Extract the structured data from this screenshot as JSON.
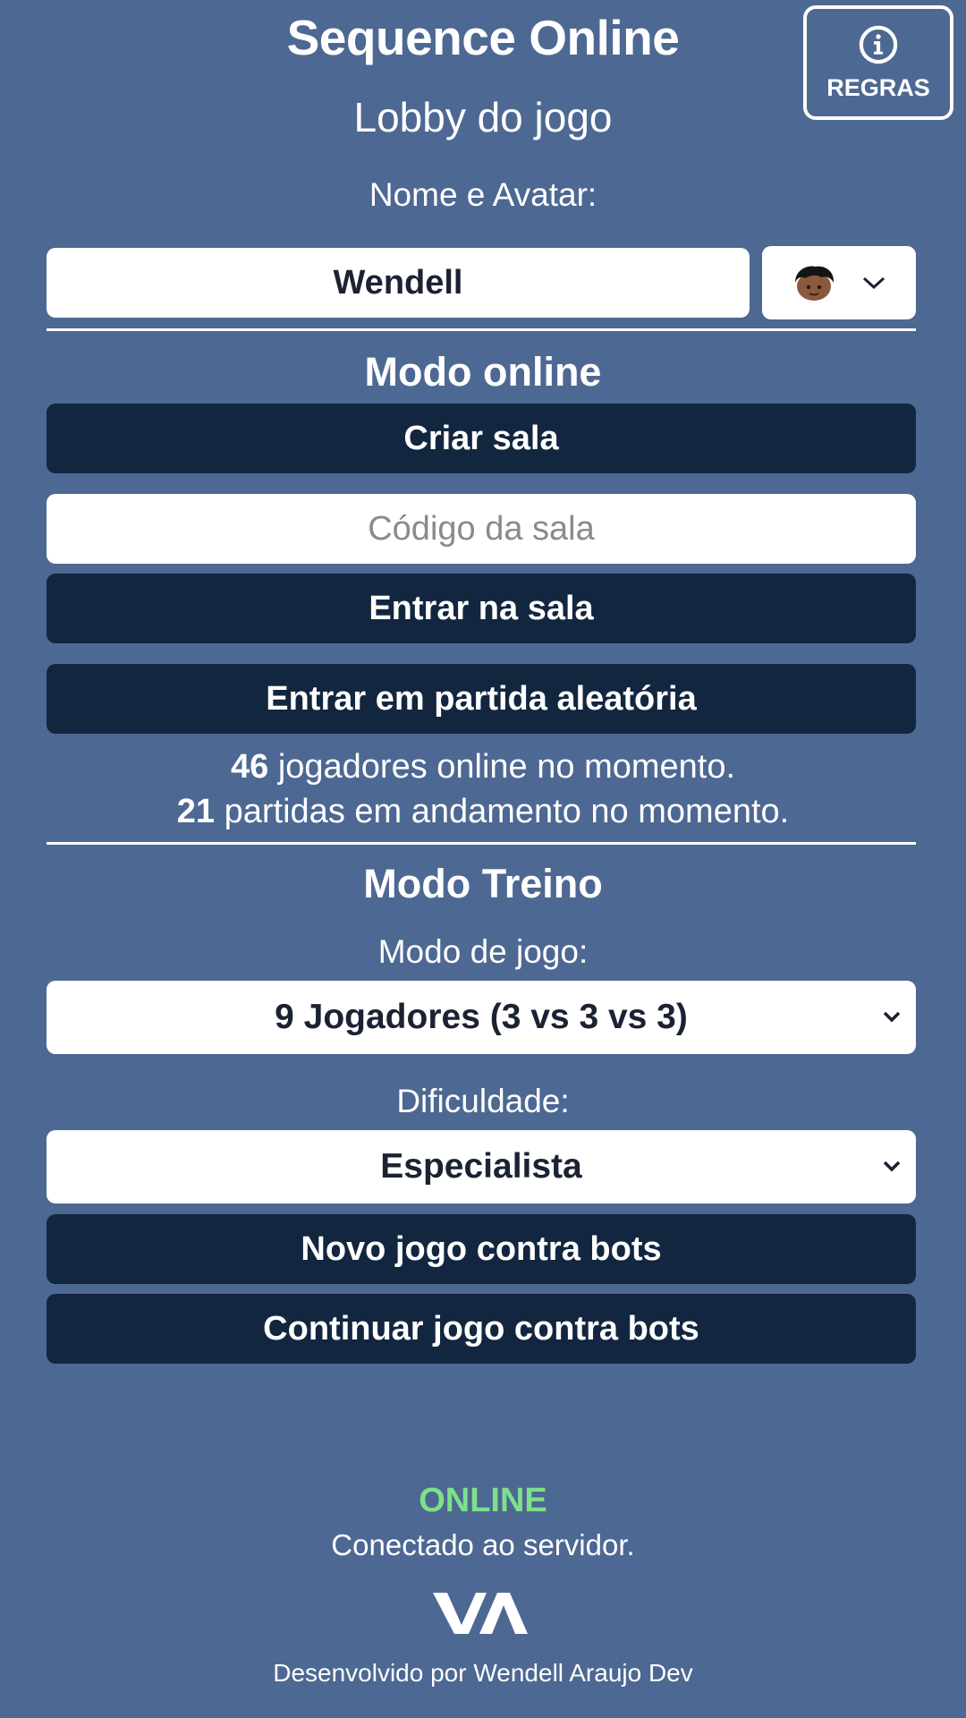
{
  "header": {
    "title": "Sequence Online",
    "subtitle": "Lobby do jogo",
    "rules_label": "REGRAS"
  },
  "profile": {
    "label": "Nome e Avatar:",
    "name_value": "Wendell"
  },
  "online_mode": {
    "title": "Modo online",
    "create_room": "Criar sala",
    "room_code_placeholder": "Código da sala",
    "join_room": "Entrar na sala",
    "random_match": "Entrar em partida aleatória",
    "players_count": "46",
    "players_text": "jogadores online no momento.",
    "matches_count": "21",
    "matches_text": "partidas em andamento no momento."
  },
  "training_mode": {
    "title": "Modo Treino",
    "game_mode_label": "Modo de jogo:",
    "game_mode_value": "9 Jogadores (3 vs 3 vs 3)",
    "difficulty_label": "Dificuldade:",
    "difficulty_value": "Especialista",
    "new_game": "Novo jogo contra bots",
    "continue_game": "Continuar jogo contra bots"
  },
  "status": {
    "state": "ONLINE",
    "message": "Conectado ao servidor."
  },
  "footer": {
    "credit": "Desenvolvido por Wendell Araujo Dev"
  },
  "colors": {
    "background": "#4d6892",
    "dark_button": "#132640",
    "online_green": "#7ee08a"
  }
}
